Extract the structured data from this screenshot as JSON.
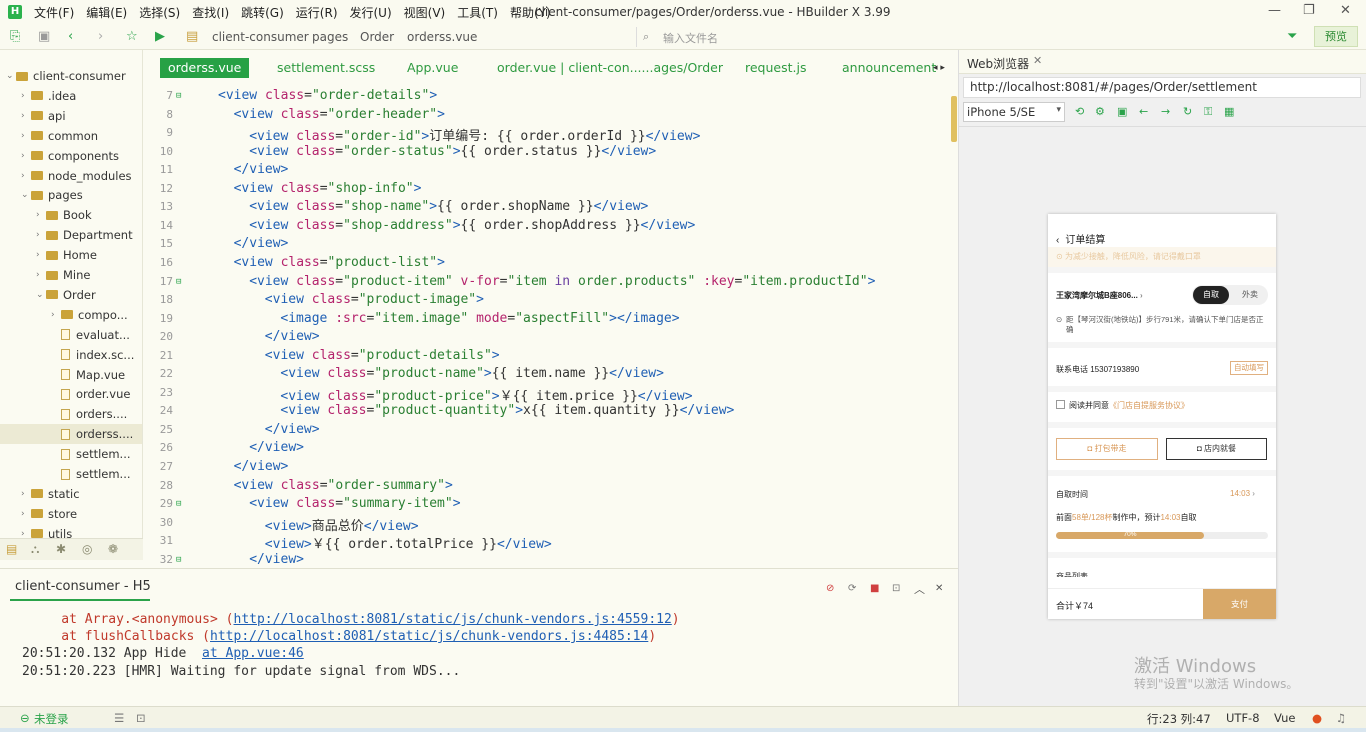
{
  "menubar": {
    "items": [
      "文件(F)",
      "编辑(E)",
      "选择(S)",
      "查找(I)",
      "跳转(G)",
      "运行(R)",
      "发行(U)",
      "视图(V)",
      "工具(T)",
      "帮助(Y)"
    ],
    "title": "client-consumer/pages/Order/orderss.vue - HBuilder X 3.99"
  },
  "toolbar": {
    "breadcrumb": [
      "client-consumer",
      "pages",
      "Order",
      "orderss.vue"
    ],
    "search_placeholder": "输入文件名",
    "preview_label": "预览"
  },
  "sidebar": {
    "items": [
      {
        "label": "client-consumer",
        "level": 0,
        "type": "root",
        "open": true
      },
      {
        "label": ".idea",
        "level": 1,
        "type": "folder"
      },
      {
        "label": "api",
        "level": 1,
        "type": "folder"
      },
      {
        "label": "common",
        "level": 1,
        "type": "folder"
      },
      {
        "label": "components",
        "level": 1,
        "type": "folder"
      },
      {
        "label": "node_modules",
        "level": 1,
        "type": "folder"
      },
      {
        "label": "pages",
        "level": 1,
        "type": "folder",
        "open": true
      },
      {
        "label": "Book",
        "level": 2,
        "type": "folder"
      },
      {
        "label": "Department",
        "level": 2,
        "type": "folder"
      },
      {
        "label": "Home",
        "level": 2,
        "type": "folder"
      },
      {
        "label": "Mine",
        "level": 2,
        "type": "folder"
      },
      {
        "label": "Order",
        "level": 2,
        "type": "folder",
        "open": true
      },
      {
        "label": "compo...",
        "level": 3,
        "type": "folder"
      },
      {
        "label": "evaluat...",
        "level": 3,
        "type": "file"
      },
      {
        "label": "index.sc...",
        "level": 3,
        "type": "file"
      },
      {
        "label": "Map.vue",
        "level": 3,
        "type": "file"
      },
      {
        "label": "order.vue",
        "level": 3,
        "type": "file"
      },
      {
        "label": "orders....",
        "level": 3,
        "type": "file"
      },
      {
        "label": "orderss....",
        "level": 3,
        "type": "file",
        "selected": true
      },
      {
        "label": "settlem...",
        "level": 3,
        "type": "file"
      },
      {
        "label": "settlem...",
        "level": 3,
        "type": "file"
      },
      {
        "label": "static",
        "level": 1,
        "type": "folder"
      },
      {
        "label": "store",
        "level": 1,
        "type": "folder"
      },
      {
        "label": "utils",
        "level": 1,
        "type": "folder"
      }
    ]
  },
  "tabs": [
    "orderss.vue",
    "settlement.scss",
    "App.vue",
    "order.vue | client-con......ages/Order",
    "request.js",
    "announcement"
  ],
  "editor": {
    "lines": [
      {
        "n": "7",
        "fold": true,
        "html": "<span class='t'>&lt;view</span> <span class='a'>class</span>=<span class='s'>\"order-details\"</span><span class='t'>&gt;</span>",
        "ind": 0
      },
      {
        "n": "8",
        "html": "<span class='t'>&lt;view</span> <span class='a'>class</span>=<span class='s'>\"order-header\"</span><span class='t'>&gt;</span>",
        "ind": 1
      },
      {
        "n": "9",
        "html": "<span class='t'>&lt;view</span> <span class='a'>class</span>=<span class='s'>\"order-id\"</span><span class='t'>&gt;</span>订单编号: {{ order.orderId }}<span class='t'>&lt;/view&gt;</span>",
        "ind": 2
      },
      {
        "n": "10",
        "html": "<span class='t'>&lt;view</span> <span class='a'>class</span>=<span class='s'>\"order-status\"</span><span class='t'>&gt;</span>{{ order.status }}<span class='t'>&lt;/view&gt;</span>",
        "ind": 2
      },
      {
        "n": "11",
        "html": "<span class='t'>&lt;/view&gt;</span>",
        "ind": 1
      },
      {
        "n": "12",
        "html": "<span class='t'>&lt;view</span> <span class='a'>class</span>=<span class='s'>\"shop-info\"</span><span class='t'>&gt;</span>",
        "ind": 1
      },
      {
        "n": "13",
        "html": "<span class='t'>&lt;view</span> <span class='a'>class</span>=<span class='s'>\"shop-name\"</span><span class='t'>&gt;</span>{{ order.shopName }}<span class='t'>&lt;/view&gt;</span>",
        "ind": 2
      },
      {
        "n": "14",
        "html": "<span class='t'>&lt;view</span> <span class='a'>class</span>=<span class='s'>\"shop-address\"</span><span class='t'>&gt;</span>{{ order.shopAddress }}<span class='t'>&lt;/view&gt;</span>",
        "ind": 2
      },
      {
        "n": "15",
        "html": "<span class='t'>&lt;/view&gt;</span>",
        "ind": 1
      },
      {
        "n": "16",
        "html": "<span class='t'>&lt;view</span> <span class='a'>class</span>=<span class='s'>\"product-list\"</span><span class='t'>&gt;</span>",
        "ind": 1
      },
      {
        "n": "17",
        "fold": true,
        "html": "<span class='t'>&lt;view</span> <span class='a'>class</span>=<span class='s'>\"product-item\"</span> <span class='a'>v-for</span>=<span class='s'>\"item <span class='k'>in</span> order.products\"</span> <span class='a'>:key</span>=<span class='s'>\"item.productId\"</span><span class='t'>&gt;</span>",
        "ind": 2
      },
      {
        "n": "18",
        "html": "<span class='t'>&lt;view</span> <span class='a'>class</span>=<span class='s'>\"product-image\"</span><span class='t'>&gt;</span>",
        "ind": 3
      },
      {
        "n": "19",
        "html": "<span class='t'>&lt;image</span> <span class='a'>:src</span>=<span class='s'>\"item.image\"</span> <span class='a'>mode</span>=<span class='s'>\"aspectFill\"</span><span class='t'>&gt;&lt;/image&gt;</span>",
        "ind": 4
      },
      {
        "n": "20",
        "html": "<span class='t'>&lt;/view&gt;</span>",
        "ind": 3
      },
      {
        "n": "21",
        "html": "<span class='t'>&lt;view</span> <span class='a'>class</span>=<span class='s'>\"product-details\"</span><span class='t'>&gt;</span>",
        "ind": 3
      },
      {
        "n": "22",
        "html": "<span class='t'>&lt;view</span> <span class='a'>class</span>=<span class='s'>\"product-name\"</span><span class='t'>&gt;</span>{{ item.name }}<span class='t'>&lt;/view&gt;</span>",
        "ind": 4
      },
      {
        "n": "23",
        "html": "<span class='t'>&lt;view</span> <span class='a'>class</span>=<span class='s'>\"product-price\"</span><span class='t'>&gt;</span>￥{{ item.price }}<span class='t'>&lt;/view&gt;</span>",
        "ind": 4
      },
      {
        "n": "24",
        "html": "<span class='t'>&lt;view</span> <span class='a'>class</span>=<span class='s'>\"product-quantity\"</span><span class='t'>&gt;</span>x{{ item.quantity }}<span class='t'>&lt;/view&gt;</span>",
        "ind": 4
      },
      {
        "n": "25",
        "html": "<span class='t'>&lt;/view&gt;</span>",
        "ind": 3
      },
      {
        "n": "26",
        "html": "<span class='t'>&lt;/view&gt;</span>",
        "ind": 2
      },
      {
        "n": "27",
        "html": "<span class='t'>&lt;/view&gt;</span>",
        "ind": 1
      },
      {
        "n": "28",
        "html": "<span class='t'>&lt;view</span> <span class='a'>class</span>=<span class='s'>\"order-summary\"</span><span class='t'>&gt;</span>",
        "ind": 1
      },
      {
        "n": "29",
        "fold": true,
        "html": "<span class='t'>&lt;view</span> <span class='a'>class</span>=<span class='s'>\"summary-item\"</span><span class='t'>&gt;</span>",
        "ind": 2
      },
      {
        "n": "30",
        "html": "<span class='t'>&lt;view&gt;</span>商品总价<span class='t'>&lt;/view&gt;</span>",
        "ind": 3
      },
      {
        "n": "31",
        "html": "<span class='t'>&lt;view&gt;</span>￥{{ order.totalPrice }}<span class='t'>&lt;/view&gt;</span>",
        "ind": 3
      },
      {
        "n": "32",
        "fold": true,
        "html": "<span class='t'>&lt;/view&gt;</span>",
        "ind": 2
      }
    ]
  },
  "console": {
    "title": "client-consumer - H5",
    "lines": [
      {
        "pre": "    at Array.<anonymous> (",
        "link": "http://localhost:8081/static/js/chunk-vendors.js:4559:12",
        "post": ")",
        "err": true
      },
      {
        "pre": "    at flushCallbacks (",
        "link": "http://localhost:8081/static/js/chunk-vendors.js:4485:14",
        "post": ")",
        "err": true
      },
      {
        "pre": "20:51:20.132 App Hide  ",
        "link": "at App.vue:46",
        "post": "",
        "err": false
      },
      {
        "pre": "20:51:20.223 [HMR] Waiting for update signal from WDS...",
        "link": "",
        "post": "",
        "err": false
      }
    ]
  },
  "browser": {
    "tab_label": "Web浏览器",
    "url": "http://localhost:8081/#/pages/Order/settlement",
    "device": "iPhone 5/SE"
  },
  "phone": {
    "title": "订单结算",
    "notice": "为减少接触，降低风险，请记得戴口罩",
    "shop_name": "王家湾摩尔城B座806...",
    "mode_pickup": "自取",
    "mode_delivery": "外卖",
    "address": "距【琴河汉街(地铁站)】步行791米，请确认下单门店是否正确",
    "phone_label": "联系电话 15307193890",
    "autofill": "自动填写",
    "agree_pre": "阅读并同意",
    "agree_link": "《门店自提服务协议》",
    "btn_pack": "打包带走",
    "btn_dinein": "店内就餐",
    "pickup_time_label": "自取时间",
    "pickup_time": "14:03",
    "queue_pre": "前面",
    "queue_cups": "58单/128杯",
    "queue_mid": "制作中，预计",
    "queue_time": "14:03",
    "queue_post": "自取",
    "progress": 0.7,
    "progress_label": "70%",
    "product_list_label": "商品列表",
    "total": "合计￥74",
    "pay": "支付"
  },
  "watermark": {
    "line1": "激活 Windows",
    "line2": "转到\"设置\"以激活 Windows。"
  },
  "status": {
    "login": "未登录",
    "position": "行:23  列:47",
    "encoding": "UTF-8",
    "lang": "Vue"
  }
}
